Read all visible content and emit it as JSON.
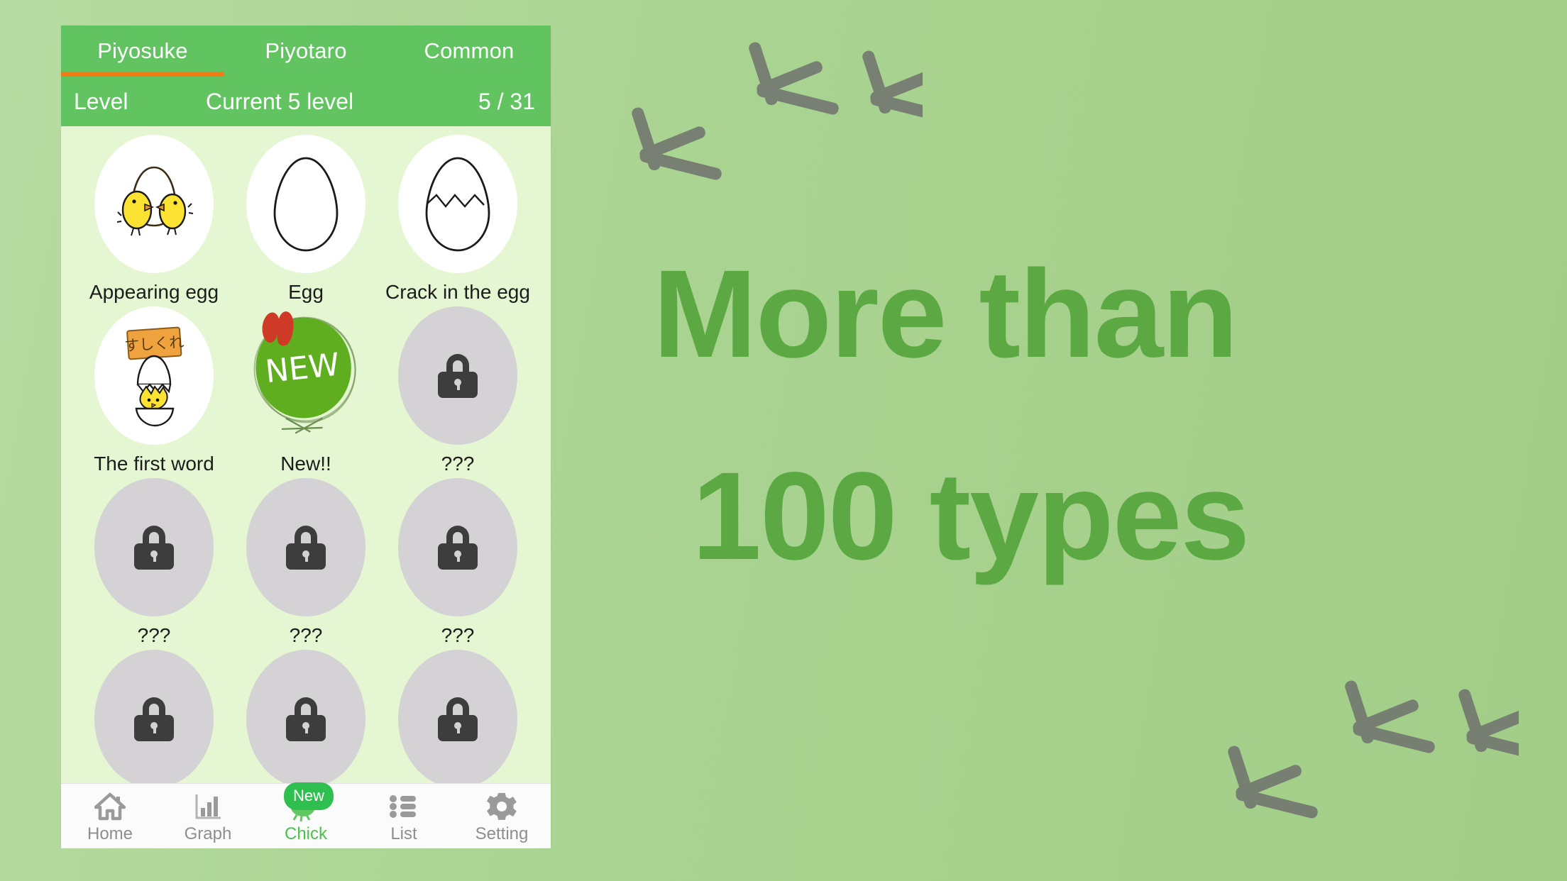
{
  "background": {
    "color_left": "#b7dba2",
    "color_right": "#a2ce88"
  },
  "headline": {
    "line1": "More than",
    "line2": "100 types",
    "color": "#5ca944"
  },
  "decoration": {
    "footprint_icon": "bird-footprint-icon",
    "footprint_color": "#6e6e6e",
    "groups": 2,
    "prints_per_group": 3
  },
  "app": {
    "accent_green": "#61c460",
    "active_underline": "#f07c17",
    "content_bg": "#e4f7d2",
    "tabs": [
      {
        "label": "Piyosuke",
        "active": true
      },
      {
        "label": "Piyotaro",
        "active": false
      },
      {
        "label": "Common",
        "active": false
      }
    ],
    "level_bar": {
      "label": "Level",
      "current": "Current 5 level",
      "count": "5 / 31"
    },
    "grid": [
      {
        "caption": "Appearing egg",
        "state": "unlocked",
        "icon": "two-chicks-hatching-icon"
      },
      {
        "caption": "Egg",
        "state": "unlocked",
        "icon": "plain-egg-icon"
      },
      {
        "caption": "Crack in the egg",
        "state": "unlocked",
        "icon": "cracked-egg-icon"
      },
      {
        "caption": "The first word",
        "state": "unlocked",
        "icon": "chick-with-sign-icon"
      },
      {
        "caption": "New!!",
        "state": "new",
        "icon": "new-balloon-icon"
      },
      {
        "caption": "???",
        "state": "locked",
        "icon": "lock-icon"
      },
      {
        "caption": "???",
        "state": "locked",
        "icon": "lock-icon"
      },
      {
        "caption": "???",
        "state": "locked",
        "icon": "lock-icon"
      },
      {
        "caption": "???",
        "state": "locked",
        "icon": "lock-icon"
      },
      {
        "caption": "",
        "state": "locked",
        "icon": "lock-icon"
      },
      {
        "caption": "",
        "state": "locked",
        "icon": "lock-icon"
      },
      {
        "caption": "",
        "state": "locked",
        "icon": "lock-icon"
      }
    ],
    "sign_text": "すしくれ",
    "balloon_text": "NEW",
    "bottom_nav": [
      {
        "label": "Home",
        "icon": "home-icon",
        "active": false,
        "badge": ""
      },
      {
        "label": "Graph",
        "icon": "bar-chart-icon",
        "active": false,
        "badge": ""
      },
      {
        "label": "Chick",
        "icon": "chick-icon",
        "active": true,
        "badge": "New"
      },
      {
        "label": "List",
        "icon": "list-icon",
        "active": false,
        "badge": ""
      },
      {
        "label": "Setting",
        "icon": "gear-icon",
        "active": false,
        "badge": ""
      }
    ]
  }
}
